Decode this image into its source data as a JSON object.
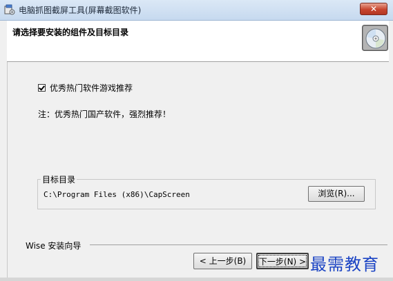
{
  "window": {
    "title": "电脑抓图截屏工具(屏幕截图软件)",
    "close_label": "✕"
  },
  "header": {
    "title": "请选择要安装的组件及目标目录",
    "icon": "cd-disc-icon"
  },
  "options": {
    "recommend_label": "优秀热门软件游戏推荐",
    "recommend_checked": true,
    "note": "注：优秀热门国产软件，强烈推荐！"
  },
  "destination": {
    "group_label": "目标目录",
    "path": "C:\\Program Files (x86)\\CapScreen",
    "browse_label": "浏览(R)..."
  },
  "footer": {
    "wise_label": "Wise 安装向导",
    "back_label": "< 上一步(B)",
    "next_label": "下一步(N) >",
    "watermark": "最需教育"
  },
  "colors": {
    "title_bar": "#c6d9ef",
    "close_button": "#c7452f",
    "watermark": "#1b44c4"
  }
}
